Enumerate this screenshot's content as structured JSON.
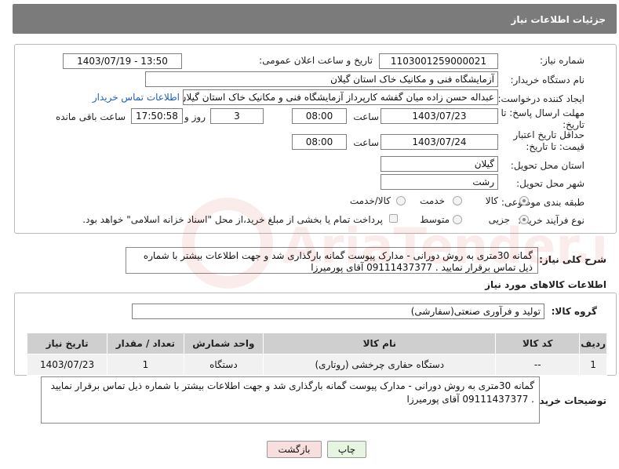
{
  "header": {
    "title": "جزئیات اطلاعات نیاز"
  },
  "form": {
    "need_number": {
      "label": "شماره نیاز:",
      "value": "1103001259000021"
    },
    "announce_datetime": {
      "label": "تاریخ و ساعت اعلان عمومی:",
      "value": "1403/07/19 - 13:50"
    },
    "buyer_org": {
      "label": "نام دستگاه خریدار:",
      "value": "آزمایشگاه فنی و مکانیک خاک استان گیلان"
    },
    "requester": {
      "label": "ایجاد کننده درخواست:",
      "value": "عبداله حسن زاده میان گفشه کارپرداز آزمایشگاه فنی و مکانیک خاک استان گیلان",
      "link": "اطلاعات تماس خریدار"
    },
    "deadline": {
      "label": "مهلت ارسال پاسخ: تا تاریخ:",
      "date": "1403/07/23",
      "time_label": "ساعت",
      "time": "08:00",
      "days": "3",
      "days_label": "روز و",
      "remaining": "17:50:58",
      "remaining_label": "ساعت باقی مانده"
    },
    "validity": {
      "label": "حداقل تاریخ اعتبار قیمت: تا تاریخ:",
      "date": "1403/07/24",
      "time_label": "ساعت",
      "time": "08:00"
    },
    "province": {
      "label": "استان محل تحویل:",
      "value": "گیلان"
    },
    "city": {
      "label": "شهر محل تحویل:",
      "value": "رشت"
    },
    "category": {
      "label": "طبقه بندی موضوعی:",
      "options": [
        "کالا",
        "خدمت",
        "کالا/خدمت"
      ],
      "selected": "کالا"
    },
    "purchase_type": {
      "label": "نوع فرآیند خرید :",
      "options": [
        "جزیی",
        "متوسط"
      ],
      "selected": "جزیی",
      "payment_note": "پرداخت تمام یا بخشی از مبلغ خرید،از محل \"اسناد خزانه اسلامی\" خواهد بود."
    }
  },
  "description": {
    "label": "شرح کلی نیاز:",
    "text": "گمانه 30متری به روش دورانی - مدارک پیوست گمانه بارگذاری شد و جهت اطلاعات بیشتر با شماره ذیل تماس برقرار نمایید . 09111437377 آقای پورمیرزا"
  },
  "goods_section": {
    "title": "اطلاعات کالاهای مورد نیاز"
  },
  "goods_group": {
    "label": "گروه کالا:",
    "value": "تولید و فرآوری صنعتی(سفارشی)"
  },
  "table": {
    "headers": [
      "ردیف",
      "کد کالا",
      "نام کالا",
      "واحد شمارش",
      "تعداد / مقدار",
      "تاریخ نیاز"
    ],
    "rows": [
      [
        "1",
        "--",
        "دستگاه حفاری چرخشی (روتاری)",
        "دستگاه",
        "1",
        "1403/07/23"
      ]
    ]
  },
  "buyer_notes": {
    "label": "توضیحات خریدار:",
    "text": "گمانه 30متری به روش دورانی - مدارک پیوست گمانه بارگذاری شد و جهت اطلاعات بیشتر با شماره ذیل تماس برقرار نمایید . 09111437377 آقای پورمیرزا"
  },
  "buttons": {
    "print": "چاپ",
    "back": "بازگشت"
  },
  "watermark": {
    "text": "AriaTender.neT"
  },
  "colors": {
    "header_bg": "#7b7b7b",
    "link": "#1a5fb4",
    "back_button_bg": "#f8dede",
    "print_button_bg": "#e5f5e0"
  }
}
